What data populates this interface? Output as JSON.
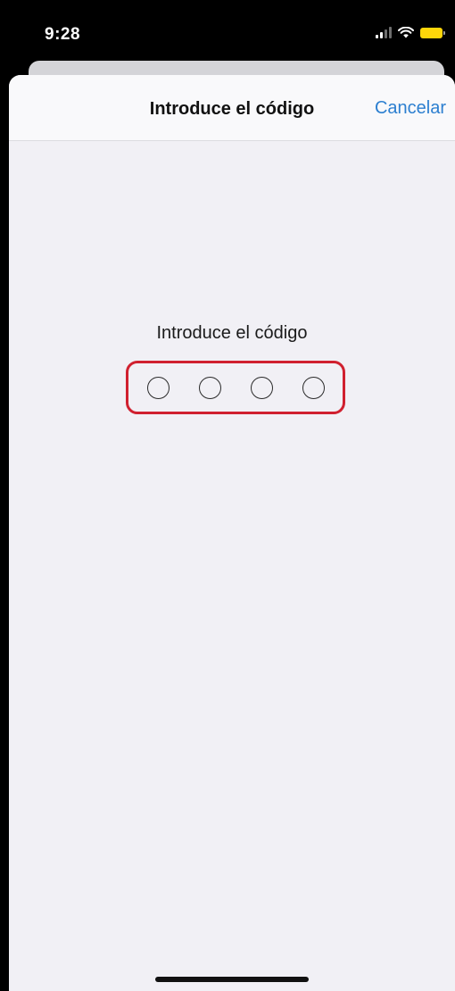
{
  "status_bar": {
    "time": "9:28",
    "icons": [
      "signal-icon",
      "wifi-icon",
      "battery-icon"
    ],
    "battery_color": "#ffd60a"
  },
  "nav": {
    "title": "Introduce el código",
    "cancel_label": "Cancelar",
    "accent_color": "#2c7fd0"
  },
  "main": {
    "prompt": "Introduce el código",
    "code_length": 4,
    "entered_digits": 0,
    "highlight_color": "#d0202f"
  }
}
